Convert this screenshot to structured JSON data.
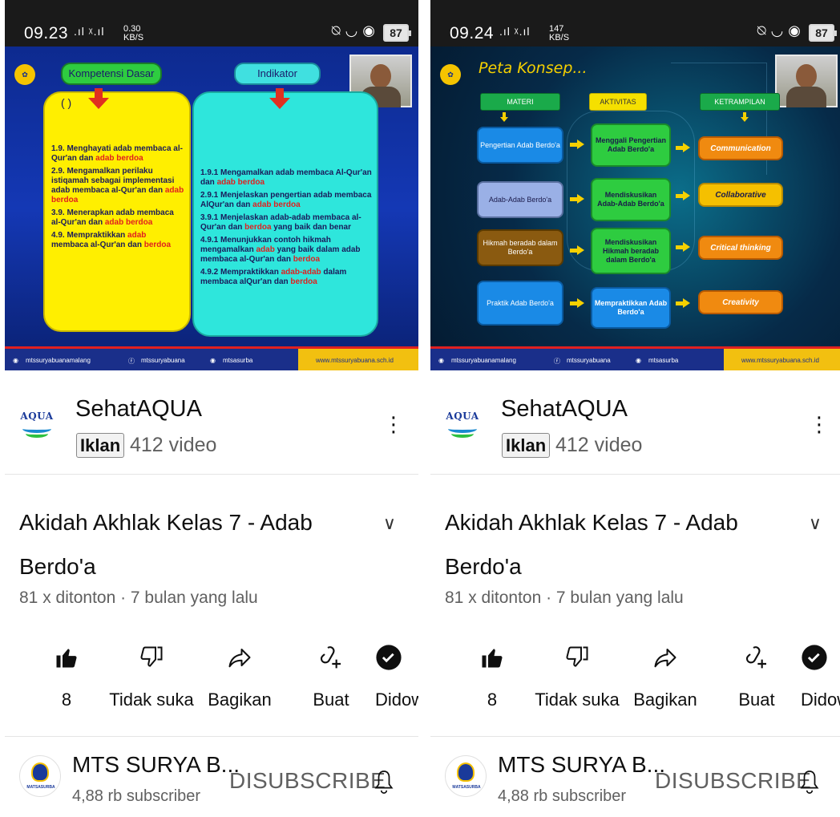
{
  "screens": [
    {
      "status": {
        "time": "09.23",
        "signal": ".ıl ᵡ.ıl",
        "speed": "0.30",
        "speed_unit": "KB/S",
        "battery": "87"
      },
      "slide": {
        "kd_title": "Kompetensi Dasar",
        "ind_title": "Indikator",
        "kd_paren": "(                    )",
        "kd_items": [
          {
            "a": "1.9. Menghayati adab membaca al-Qur'an dan ",
            "r": "adab berdoa",
            "b": ""
          },
          {
            "a": "2.9. Mengamalkan perilaku istiqamah sebagai implementasi adab membaca al-Qur'an dan ",
            "r": "adab berdoa",
            "b": ""
          },
          {
            "a": "3.9. Menerapkan adab membaca al-Qur'an dan ",
            "r": "adab berdoa",
            "b": ""
          },
          {
            "a": "4.9. Mempraktikkan ",
            "r": "adab",
            "b": " membaca al-Qur'an dan ",
            "r2": "berdoa"
          }
        ],
        "ind_items": [
          {
            "a": "1.9.1 Mengamalkan adab membaca Al-Qur'an dan ",
            "r": "adab berdoa",
            "b": ""
          },
          {
            "a": "2.9.1 Menjelaskan pengertian adab membaca AlQur'an dan ",
            "r": "adab berdoa",
            "b": ""
          },
          {
            "a": "3.9.1 Menjelaskan adab-adab membaca al-Qur'an dan ",
            "r": "berdoa",
            "b": " yang baik dan benar"
          },
          {
            "a": "4.9.1 Menunjukkan contoh hikmah mengamalkan ",
            "r": "adab",
            "b": " yang baik dalam adab membaca al-Qur'an dan ",
            "r2": "berdoa"
          },
          {
            "a": "4.9.2 Mempraktikkan ",
            "r": "adab-adab",
            "b": " dalam membaca alQur'an dan ",
            "r2": "berdoa"
          }
        ],
        "footer": {
          "ig1": "mtssuryabuanamalang",
          "fb": "mtssuryabuana",
          "ig2": "mtsasurba",
          "web": "www.mtssuryabuana.sch.id"
        }
      }
    },
    {
      "status": {
        "time": "09.24",
        "signal": ".ıl ᵡ.ıl",
        "speed": "147",
        "speed_unit": "KB/S",
        "battery": "87"
      },
      "slide": {
        "title": "Peta Konsep...",
        "h_materi": "MATERI",
        "h_aktivitas": "AKTIVITAS",
        "h_ketrampilan": "KETRAMPILAN",
        "materi": [
          "Pengertian Adab Berdo'a",
          "Adab-Adab Berdo'a",
          "Hikmah beradab dalam Berdo'a",
          "Praktik Adab Berdo'a"
        ],
        "aktivitas": [
          "Menggali Pengertian Adab Berdo'a",
          "Mendiskusikan Adab-Adab Berdo'a",
          "Mendiskusikan Hikmah beradab dalam Berdo'a",
          "Mempraktikkan Adab Berdo'a"
        ],
        "ketrampilan": [
          "Communication",
          "Collaborative",
          "Critical thinking",
          "Creativity"
        ],
        "footer": {
          "ig1": "mtssuryabuanamalang",
          "fb": "mtssuryabuana",
          "ig2": "mtsasurba",
          "web": "www.mtssuryabuana.sch.id"
        }
      }
    }
  ],
  "ad": {
    "logo_text": "AQUA",
    "channel": "SehatAQUA",
    "badge": "Iklan",
    "videos": "412 video"
  },
  "video": {
    "title": "Akidah Akhlak Kelas 7 - Adab Berdo'a",
    "meta": "81 x ditonton · 7 bulan yang lalu"
  },
  "actions": {
    "like_count": "8",
    "dislike": "Tidak suka",
    "share": "Bagikan",
    "create": "Buat",
    "download": "Didownload"
  },
  "channel": {
    "name": "MTS SURYA B...",
    "subs": "4,88 rb subscriber",
    "unsub": "DISUBSCRIBE",
    "logo_caption": "MATSASURBA"
  },
  "colors": {
    "accent_red": "#e02020",
    "slide_blue": "#1438b5",
    "kd_yellow": "#ffef00",
    "ind_cyan": "#2ee6dc"
  }
}
